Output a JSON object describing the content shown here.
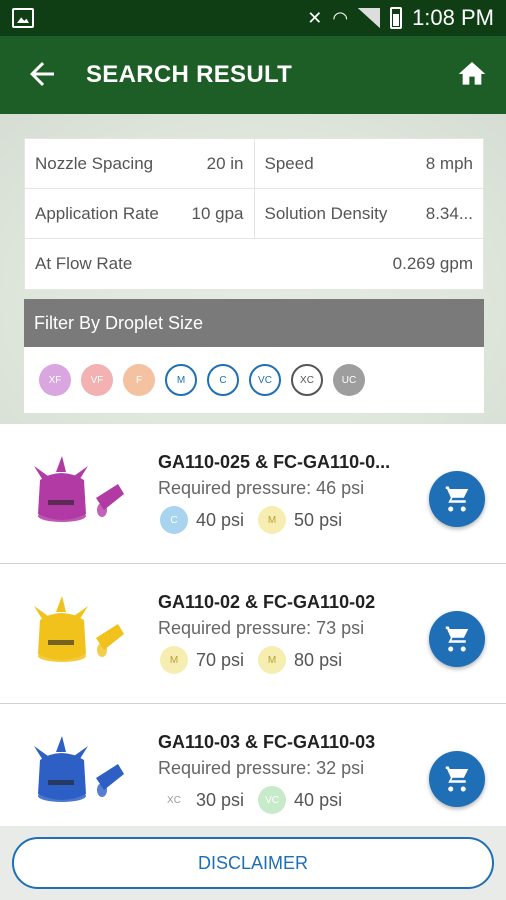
{
  "status_bar": {
    "time": "1:08 PM"
  },
  "app_bar": {
    "title": "SEARCH RESULT"
  },
  "params": {
    "nozzle_spacing": {
      "label": "Nozzle Spacing",
      "value": "20 in"
    },
    "speed": {
      "label": "Speed",
      "value": "8 mph"
    },
    "application_rate": {
      "label": "Application Rate",
      "value": "10 gpa"
    },
    "solution_density": {
      "label": "Solution Density",
      "value": "8.34..."
    },
    "flow_rate": {
      "label": "At Flow Rate",
      "value": "0.269 gpm"
    }
  },
  "filter": {
    "title": "Filter By Droplet Size",
    "chips": [
      {
        "label": "XF",
        "color": "#d9a6e0",
        "outline": false
      },
      {
        "label": "VF",
        "color": "#f4b1b1",
        "outline": false
      },
      {
        "label": "F",
        "color": "#f5c2a1",
        "outline": false
      },
      {
        "label": "M",
        "color": "#1e6fb5",
        "outline": true
      },
      {
        "label": "C",
        "color": "#1e6fb5",
        "outline": true
      },
      {
        "label": "VC",
        "color": "#1e6fb5",
        "outline": true
      },
      {
        "label": "XC",
        "color": "#555555",
        "outline": true
      },
      {
        "label": "UC",
        "color": "#9e9e9e",
        "outline": false
      }
    ]
  },
  "results": [
    {
      "name": "GA110-025 & FC-GA110-0...",
      "pressure": "Required pressure: 46 psi",
      "color": "#b13aa5",
      "badge1": {
        "label": "C",
        "color": "#a9d4f0",
        "value": "40 psi"
      },
      "badge2": {
        "label": "M",
        "color": "#f6eeb0",
        "value": "50 psi"
      }
    },
    {
      "name": "GA110-02 & FC-GA110-02",
      "pressure": "Required pressure: 73 psi",
      "color": "#f1c21b",
      "badge1": {
        "label": "M",
        "color": "#f6eeb0",
        "value": "70 psi"
      },
      "badge2": {
        "label": "M",
        "color": "#f6eeb0",
        "value": "80 psi"
      }
    },
    {
      "name": "GA110-03 & FC-GA110-03",
      "pressure": "Required pressure: 32 psi",
      "color": "#2d5fc5",
      "badge1": {
        "label": "XC",
        "color": "#ffffff",
        "value": "30 psi"
      },
      "badge2": {
        "label": "VC",
        "color": "#c7eac8",
        "value": "40 psi"
      }
    }
  ],
  "footer": {
    "disclaimer": "DISCLAIMER"
  }
}
